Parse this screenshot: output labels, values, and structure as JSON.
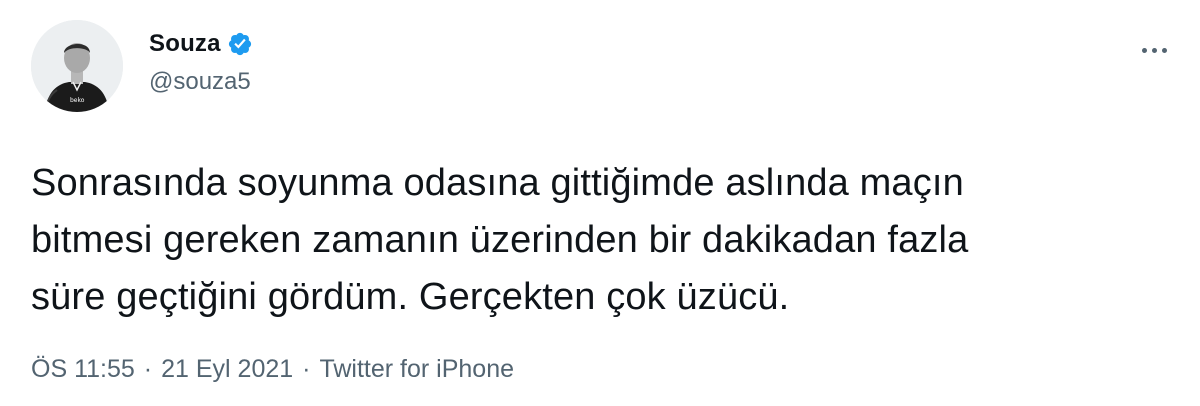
{
  "author": {
    "display_name": "Souza",
    "handle": "@souza5",
    "verified": true,
    "avatar_icon": "player-avatar-icon",
    "avatar_shirt_text": "beko"
  },
  "tweet": {
    "lines": [
      "Sonrasında soyunma odasına gittiğimde aslında maçın",
      "bitmesi gereken zamanın üzerinden bir dakikadan fazla",
      "süre geçtiğini gördüm. Gerçekten çok üzücü."
    ]
  },
  "meta": {
    "time": "ÖS 11:55",
    "date": "21 Eyl 2021",
    "source": "Twitter for iPhone",
    "separator": "·"
  },
  "icons": {
    "verified": "verified-badge-icon",
    "more": "more-options-icon"
  },
  "colors": {
    "verified": "#1d9bf0",
    "text_primary": "#0f1419",
    "text_secondary": "#536471",
    "background": "#ffffff"
  }
}
